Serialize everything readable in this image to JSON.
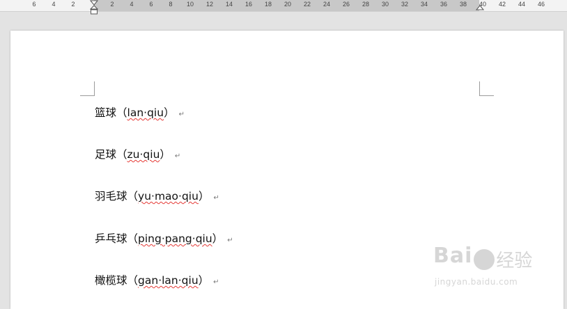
{
  "ruler": {
    "ticks": [
      "6",
      "4",
      "2",
      "2",
      "4",
      "6",
      "8",
      "10",
      "12",
      "14",
      "16",
      "18",
      "20",
      "22",
      "24",
      "26",
      "28",
      "30",
      "32",
      "34",
      "36",
      "38",
      "40",
      "42",
      "44",
      "46"
    ]
  },
  "document": {
    "lines": [
      {
        "hanzi": "篮球",
        "open": "（",
        "pinyin": "lan·qiu",
        "close": "）",
        "mark": "↵"
      },
      {
        "hanzi": "足球",
        "open": "（",
        "pinyin": "zu·qiu",
        "close": "）",
        "mark": "↵"
      },
      {
        "hanzi": "羽毛球",
        "open": "（",
        "pinyin": "yu·mao·qiu",
        "close": "）",
        "mark": "↵"
      },
      {
        "hanzi": "乒乓球",
        "open": "（",
        "pinyin": "ping·pang·qiu",
        "close": "）",
        "mark": "↵"
      },
      {
        "hanzi": "橄榄球",
        "open": "（",
        "pinyin": "gan·lan·qiu",
        "close": "）",
        "mark": "↵"
      }
    ]
  },
  "watermark": {
    "logo_left": "Bai",
    "logo_right": "经验",
    "url": "jingyan.baidu.com"
  }
}
